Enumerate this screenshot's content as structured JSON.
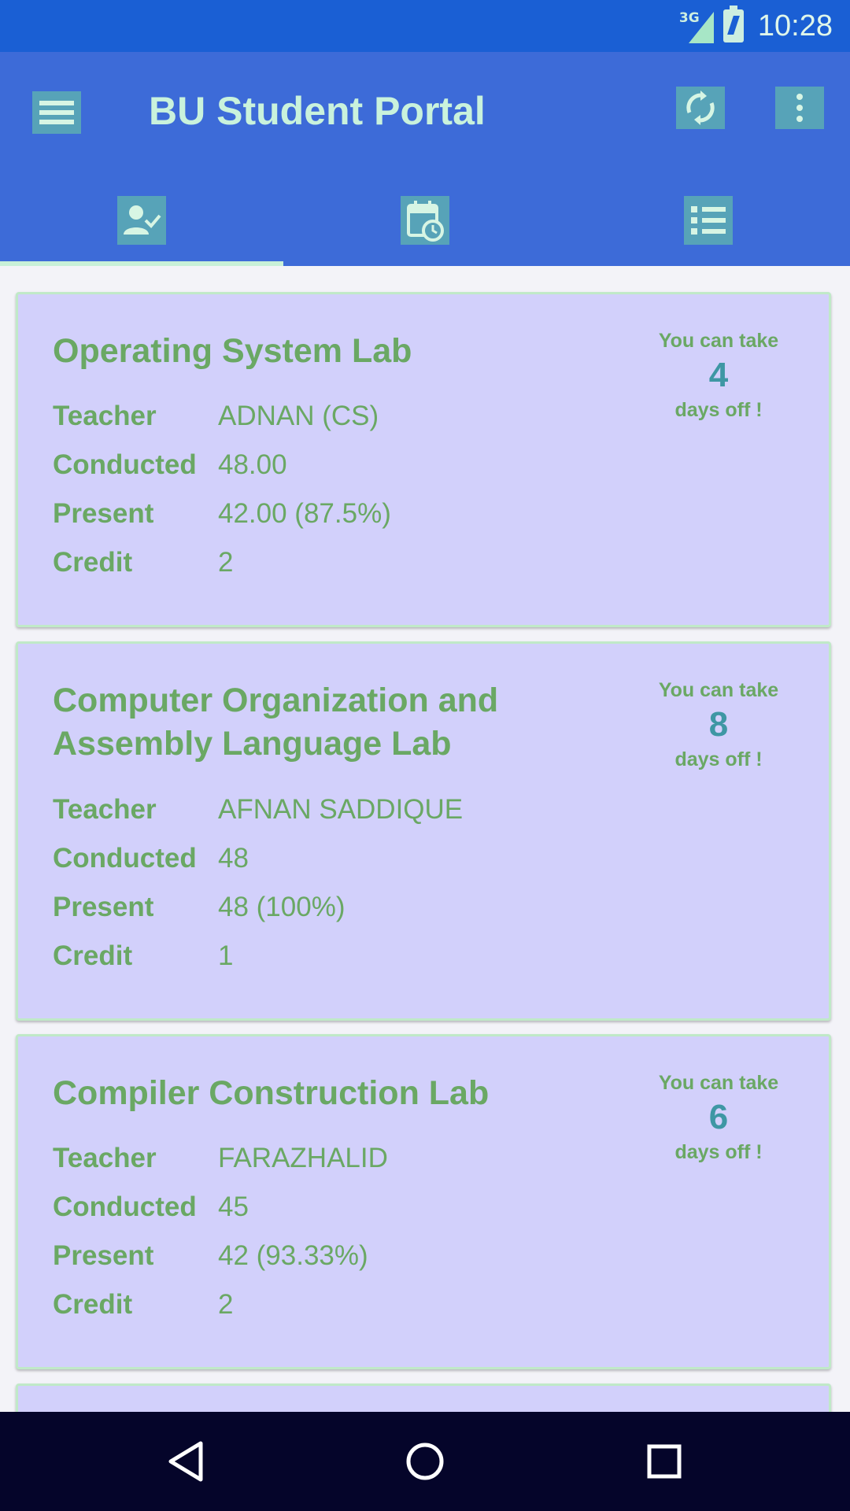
{
  "status_bar": {
    "network": "3G",
    "time": "10:28"
  },
  "app_bar": {
    "title": "BU Student Portal"
  },
  "tabs": [
    {
      "icon": "attendance-icon"
    },
    {
      "icon": "schedule-icon"
    },
    {
      "icon": "list-icon"
    }
  ],
  "courses": [
    {
      "title": "Operating System Lab",
      "teacher_label": "Teacher",
      "teacher": "ADNAN (CS)",
      "conducted_label": "Conducted",
      "conducted": "48.00",
      "present_label": "Present",
      "present": "42.00 (87.5%)",
      "credit_label": "Credit",
      "credit": "2",
      "off_prefix": "You can take",
      "off_days": "4",
      "off_suffix": "days off !"
    },
    {
      "title": "Computer Organization and Assembly Language Lab",
      "teacher_label": "Teacher",
      "teacher": "AFNAN SADDIQUE",
      "conducted_label": "Conducted",
      "conducted": "48",
      "present_label": "Present",
      "present": "48 (100%)",
      "credit_label": "Credit",
      "credit": "1",
      "off_prefix": "You can take",
      "off_days": "8",
      "off_suffix": "days off !"
    },
    {
      "title": "Compiler Construction Lab",
      "teacher_label": "Teacher",
      "teacher": "FARAZHALID",
      "conducted_label": "Conducted",
      "conducted": "45",
      "present_label": "Present",
      "present": "42 (93.33%)",
      "credit_label": "Credit",
      "credit": "2",
      "off_prefix": "You can take",
      "off_days": "6",
      "off_suffix": "days off !"
    }
  ],
  "colors": {
    "status_bar": "#1a5fd4",
    "app_bar": "#3d6bd8",
    "card": "#d2d0fb",
    "label_green": "#6aa864",
    "number_teal": "#3e97a4",
    "nav_bar": "#05052a"
  }
}
